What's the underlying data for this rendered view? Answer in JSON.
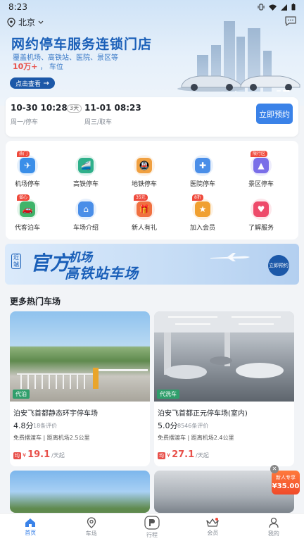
{
  "status_bar": {
    "time": "8:23"
  },
  "header": {
    "location": "北京"
  },
  "hero": {
    "title": "网约停车服务连锁门店",
    "subtitle": "覆盖机场、高铁站、医院、景区等",
    "stat_value": "10万+",
    "stat_unit": "车位",
    "cta": "点击查看"
  },
  "reservation": {
    "start_datetime": "10-30 10:28",
    "start_sub": "周一/停车",
    "duration": "3天",
    "end_datetime": "11-01 08:23",
    "end_sub": "周三/取车",
    "button": "立即预约"
  },
  "services": [
    {
      "label": "机场停车",
      "badge": "热门",
      "color": "#3a8ee8",
      "icon": "plane-parking-icon"
    },
    {
      "label": "高铁停车",
      "badge": "",
      "color": "#2fb08a",
      "icon": "train-parking-icon"
    },
    {
      "label": "地铁停车",
      "badge": "",
      "color": "#f0a040",
      "icon": "subway-parking-icon"
    },
    {
      "label": "医院停车",
      "badge": "",
      "color": "#4a8ee8",
      "icon": "hospital-parking-icon"
    },
    {
      "label": "景区停车",
      "badge": "限行区",
      "color": "#7a6ee8",
      "icon": "scenic-parking-icon"
    },
    {
      "label": "代客泊车",
      "badge": "省心",
      "color": "#3fb46a",
      "icon": "valet-icon"
    },
    {
      "label": "车场介绍",
      "badge": "",
      "color": "#4a8ee8",
      "icon": "store-icon"
    },
    {
      "label": "新人有礼",
      "badge": "35元",
      "color": "#f07040",
      "icon": "gift-icon"
    },
    {
      "label": "加入会员",
      "badge": "8折",
      "color": "#f0a030",
      "icon": "member-icon"
    },
    {
      "label": "了解服务",
      "badge": "",
      "color": "#ee4a6a",
      "icon": "heart-icon"
    }
  ],
  "promo": {
    "near_label": "近端",
    "official": "官方",
    "line1": "机场",
    "line2": "高铁站车场",
    "button": "立即预约"
  },
  "section_title": "更多热门车场",
  "parkings": [
    {
      "tag": "代泊",
      "name": "泊安飞首都静态环宇停车场",
      "score": "4.8分",
      "reviews": "18条评价",
      "desc": "免费摆渡车 | 距离机场2.5公里",
      "price_tag": "均",
      "price": "19.1",
      "unit": "/天起"
    },
    {
      "tag": "代洗车",
      "name": "泊安飞首都正元停车场(室内)",
      "score": "5.0分",
      "reviews": "8546条评价",
      "desc": "免费摆渡车 | 距离机场2.4公里",
      "price_tag": "均",
      "price": "27.1",
      "unit": "/天起"
    }
  ],
  "new_user": {
    "label": "新人专享",
    "amount": "35.00"
  },
  "tabs": [
    {
      "label": "首页",
      "icon": "home-icon",
      "active": true
    },
    {
      "label": "车场",
      "icon": "location-icon",
      "active": false
    },
    {
      "label": "行程",
      "icon": "trip-icon",
      "active": false
    },
    {
      "label": "会员",
      "icon": "crown-icon",
      "active": false
    },
    {
      "label": "我的",
      "icon": "user-icon",
      "active": false
    }
  ]
}
